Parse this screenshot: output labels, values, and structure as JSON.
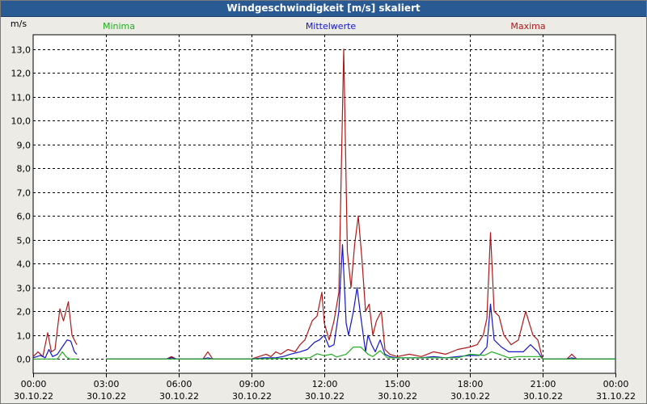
{
  "window": {
    "title": "Windgeschwindigkeit [m/s] skaliert"
  },
  "colors": {
    "minima": "#1fae1f",
    "mittelwerte": "#1616c8",
    "maxima": "#b01818",
    "grid": "#000000",
    "plot_bg": "#ffffff",
    "window_bg": "#ecebe6",
    "title_bg": "#2a5a94"
  },
  "chart_data": {
    "type": "line",
    "title": "Windgeschwindigkeit [m/s] skaliert",
    "ylabel": "m/s",
    "xlabel": "",
    "ylim": [
      -0.6,
      13.6
    ],
    "xlim": [
      0,
      24
    ],
    "grid": true,
    "legend_placement": "top",
    "yticks": [
      0,
      1,
      2,
      3,
      4,
      5,
      6,
      7,
      8,
      9,
      10,
      11,
      12,
      13
    ],
    "ytick_labels": [
      "0,0",
      "1,0",
      "2,0",
      "3,0",
      "4,0",
      "5,0",
      "6,0",
      "7,0",
      "8,0",
      "9,0",
      "10,0",
      "11,0",
      "12,0",
      "13,0"
    ],
    "xticks": [
      {
        "time": "00:00",
        "date": "30.10.22",
        "hour": 0
      },
      {
        "time": "03:00",
        "date": "30.10.22",
        "hour": 3
      },
      {
        "time": "06:00",
        "date": "30.10.22",
        "hour": 6
      },
      {
        "time": "09:00",
        "date": "30.10.22",
        "hour": 9
      },
      {
        "time": "12:00",
        "date": "30.10.22",
        "hour": 12
      },
      {
        "time": "15:00",
        "date": "30.10.22",
        "hour": 15
      },
      {
        "time": "18:00",
        "date": "30.10.22",
        "hour": 18
      },
      {
        "time": "21:00",
        "date": "30.10.22",
        "hour": 21
      },
      {
        "time": "00:00",
        "date": "31.10.22",
        "hour": 24
      }
    ],
    "series": [
      {
        "name": "Minima",
        "key": "minima",
        "points": [
          [
            [
              0,
              0
            ],
            [
              1.0,
              0
            ],
            [
              1.2,
              0.3
            ],
            [
              1.35,
              0.1
            ],
            [
              1.5,
              0
            ],
            [
              1.8,
              0
            ]
          ],
          [
            [
              3,
              0
            ],
            [
              9,
              0
            ],
            [
              10.8,
              0.03
            ],
            [
              11.4,
              0.05
            ],
            [
              11.7,
              0.22
            ],
            [
              12.0,
              0.14
            ],
            [
              12.3,
              0.2
            ],
            [
              12.5,
              0.08
            ],
            [
              12.9,
              0.2
            ],
            [
              13.2,
              0.5
            ],
            [
              13.5,
              0.5
            ],
            [
              13.8,
              0.2
            ],
            [
              14.0,
              0.1
            ],
            [
              14.3,
              0.35
            ],
            [
              14.6,
              0.05
            ],
            [
              15,
              0.05
            ],
            [
              16,
              0.05
            ],
            [
              17.5,
              0.05
            ],
            [
              18.0,
              0.2
            ],
            [
              18.6,
              0.15
            ],
            [
              18.9,
              0.3
            ],
            [
              19.2,
              0.2
            ],
            [
              19.6,
              0.05
            ],
            [
              20.0,
              0.1
            ],
            [
              20.5,
              0.1
            ],
            [
              20.9,
              0.1
            ],
            [
              21,
              0
            ],
            [
              24,
              0
            ]
          ]
        ]
      },
      {
        "name": "Mittelwerte",
        "key": "mittelwerte",
        "points": [
          [
            [
              0,
              0.05
            ],
            [
              0.3,
              0.15
            ],
            [
              0.5,
              0.05
            ],
            [
              0.65,
              0.4
            ],
            [
              0.8,
              0.1
            ],
            [
              1.0,
              0.2
            ],
            [
              1.2,
              0.5
            ],
            [
              1.4,
              0.8
            ],
            [
              1.55,
              0.75
            ],
            [
              1.7,
              0.3
            ],
            [
              1.8,
              0.2
            ]
          ],
          [
            [
              3,
              0
            ],
            [
              5.5,
              0
            ],
            [
              5.7,
              0.05
            ],
            [
              5.9,
              0
            ],
            [
              7.0,
              0
            ],
            [
              7.2,
              0.05
            ],
            [
              7.4,
              0
            ],
            [
              9.0,
              0
            ],
            [
              9.5,
              0.05
            ],
            [
              10.0,
              0.05
            ],
            [
              10.3,
              0.1
            ],
            [
              10.6,
              0.2
            ],
            [
              11.0,
              0.3
            ],
            [
              11.3,
              0.4
            ],
            [
              11.6,
              0.7
            ],
            [
              11.8,
              0.8
            ],
            [
              12.0,
              1.0
            ],
            [
              12.2,
              0.5
            ],
            [
              12.4,
              0.6
            ],
            [
              12.6,
              2.0
            ],
            [
              12.75,
              4.8
            ],
            [
              12.9,
              1.5
            ],
            [
              13.0,
              1.0
            ],
            [
              13.2,
              2.0
            ],
            [
              13.35,
              3.0
            ],
            [
              13.5,
              1.8
            ],
            [
              13.7,
              0.3
            ],
            [
              13.8,
              1.0
            ],
            [
              13.95,
              0.6
            ],
            [
              14.1,
              0.3
            ],
            [
              14.3,
              0.8
            ],
            [
              14.5,
              0.2
            ],
            [
              14.7,
              0.1
            ],
            [
              15.0,
              0.05
            ],
            [
              15.5,
              0.05
            ],
            [
              16.0,
              0.05
            ],
            [
              16.5,
              0.1
            ],
            [
              17.0,
              0.05
            ],
            [
              17.5,
              0.1
            ],
            [
              18.0,
              0.15
            ],
            [
              18.4,
              0.15
            ],
            [
              18.7,
              0.5
            ],
            [
              18.85,
              2.3
            ],
            [
              19.0,
              0.8
            ],
            [
              19.3,
              0.5
            ],
            [
              19.6,
              0.3
            ],
            [
              19.9,
              0.3
            ],
            [
              20.2,
              0.3
            ],
            [
              20.5,
              0.6
            ],
            [
              20.8,
              0.3
            ],
            [
              21.0,
              0
            ],
            [
              22.0,
              0
            ],
            [
              22.2,
              0.05
            ],
            [
              22.4,
              0
            ],
            [
              24,
              0
            ]
          ]
        ]
      },
      {
        "name": "Maxima",
        "key": "maxima",
        "points": [
          [
            [
              0,
              0.1
            ],
            [
              0.2,
              0.3
            ],
            [
              0.4,
              0.1
            ],
            [
              0.6,
              1.1
            ],
            [
              0.75,
              0.3
            ],
            [
              0.9,
              0.4
            ],
            [
              1.1,
              2.1
            ],
            [
              1.25,
              1.6
            ],
            [
              1.45,
              2.4
            ],
            [
              1.6,
              1.0
            ],
            [
              1.8,
              0.6
            ]
          ],
          [
            [
              3,
              0
            ],
            [
              5.5,
              0
            ],
            [
              5.7,
              0.1
            ],
            [
              5.9,
              0
            ],
            [
              7.0,
              0
            ],
            [
              7.2,
              0.3
            ],
            [
              7.4,
              0
            ],
            [
              9.0,
              0
            ],
            [
              9.3,
              0.1
            ],
            [
              9.6,
              0.2
            ],
            [
              9.8,
              0.1
            ],
            [
              10.0,
              0.3
            ],
            [
              10.2,
              0.2
            ],
            [
              10.5,
              0.4
            ],
            [
              10.8,
              0.3
            ],
            [
              11.0,
              0.6
            ],
            [
              11.2,
              0.8
            ],
            [
              11.5,
              1.6
            ],
            [
              11.7,
              1.8
            ],
            [
              11.9,
              2.8
            ],
            [
              12.0,
              1.5
            ],
            [
              12.2,
              0.8
            ],
            [
              12.4,
              1.6
            ],
            [
              12.6,
              2.8
            ],
            [
              12.8,
              13.0
            ],
            [
              12.95,
              4.5
            ],
            [
              13.1,
              3.0
            ],
            [
              13.25,
              4.8
            ],
            [
              13.4,
              6.0
            ],
            [
              13.55,
              4.2
            ],
            [
              13.7,
              2.0
            ],
            [
              13.85,
              2.3
            ],
            [
              14.0,
              1.0
            ],
            [
              14.15,
              1.6
            ],
            [
              14.35,
              2.0
            ],
            [
              14.5,
              0.4
            ],
            [
              14.7,
              0.2
            ],
            [
              15.0,
              0.1
            ],
            [
              15.5,
              0.2
            ],
            [
              16.0,
              0.1
            ],
            [
              16.5,
              0.3
            ],
            [
              17.0,
              0.2
            ],
            [
              17.5,
              0.4
            ],
            [
              18.0,
              0.5
            ],
            [
              18.3,
              0.6
            ],
            [
              18.55,
              1.0
            ],
            [
              18.7,
              1.7
            ],
            [
              18.85,
              5.3
            ],
            [
              19.0,
              2.0
            ],
            [
              19.2,
              1.8
            ],
            [
              19.4,
              1.0
            ],
            [
              19.7,
              0.6
            ],
            [
              20.0,
              0.8
            ],
            [
              20.3,
              2.0
            ],
            [
              20.6,
              1.0
            ],
            [
              20.8,
              0.8
            ],
            [
              21.0,
              0
            ],
            [
              22.0,
              0
            ],
            [
              22.2,
              0.2
            ],
            [
              22.4,
              0
            ],
            [
              24,
              0
            ]
          ]
        ]
      }
    ]
  }
}
